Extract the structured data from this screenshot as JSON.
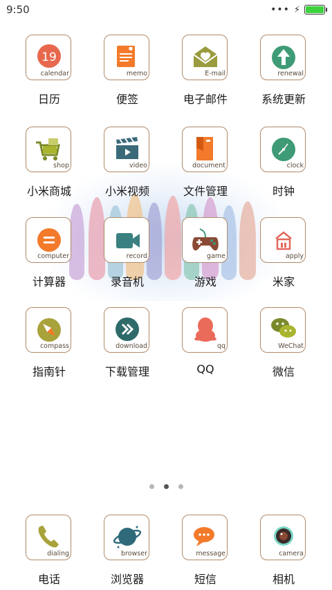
{
  "status": {
    "time": "9:50",
    "battery_level": 0.92,
    "battery_color": "#3fd23f"
  },
  "rows": [
    [
      {
        "name": "日历",
        "tag": "calendar",
        "badge": "19",
        "icon": "calendar-icon"
      },
      {
        "name": "便签",
        "tag": "memo",
        "icon": "memo-icon"
      },
      {
        "name": "电子邮件",
        "tag": "E-mail",
        "icon": "email-icon"
      },
      {
        "name": "系统更新",
        "tag": "renewal",
        "icon": "update-icon"
      }
    ],
    [
      {
        "name": "小米商城",
        "tag": "shop",
        "icon": "shop-cart-icon"
      },
      {
        "name": "小米视频",
        "tag": "video",
        "icon": "video-clapper-icon"
      },
      {
        "name": "文件管理",
        "tag": "document",
        "icon": "folder-icon"
      },
      {
        "name": "时钟",
        "tag": "clock",
        "icon": "clock-icon"
      }
    ],
    [
      {
        "name": "计算器",
        "tag": "computer",
        "icon": "calculator-icon"
      },
      {
        "name": "录音机",
        "tag": "record",
        "icon": "recorder-icon"
      },
      {
        "name": "游戏",
        "tag": "game",
        "icon": "gamepad-icon"
      },
      {
        "name": "米家",
        "tag": "apply",
        "icon": "mi-home-icon"
      }
    ],
    [
      {
        "name": "指南针",
        "tag": "compass",
        "icon": "compass-icon"
      },
      {
        "name": "下载管理",
        "tag": "download",
        "icon": "download-icon"
      },
      {
        "name": "QQ",
        "tag": "qq",
        "icon": "qq-penguin-icon"
      },
      {
        "name": "微信",
        "tag": "WeChat",
        "icon": "wechat-icon"
      }
    ]
  ],
  "dock": [
    {
      "name": "电话",
      "tag": "dialing",
      "icon": "phone-icon"
    },
    {
      "name": "浏览器",
      "tag": "browser",
      "icon": "browser-planet-icon"
    },
    {
      "name": "短信",
      "tag": "message",
      "icon": "message-bubble-icon"
    },
    {
      "name": "相机",
      "tag": "camera",
      "icon": "camera-lens-icon"
    }
  ],
  "pager": {
    "pages": 3,
    "active": 1
  },
  "colors": {
    "tile_border": "#b08a6a",
    "tag_text": "#5a4a3a"
  }
}
